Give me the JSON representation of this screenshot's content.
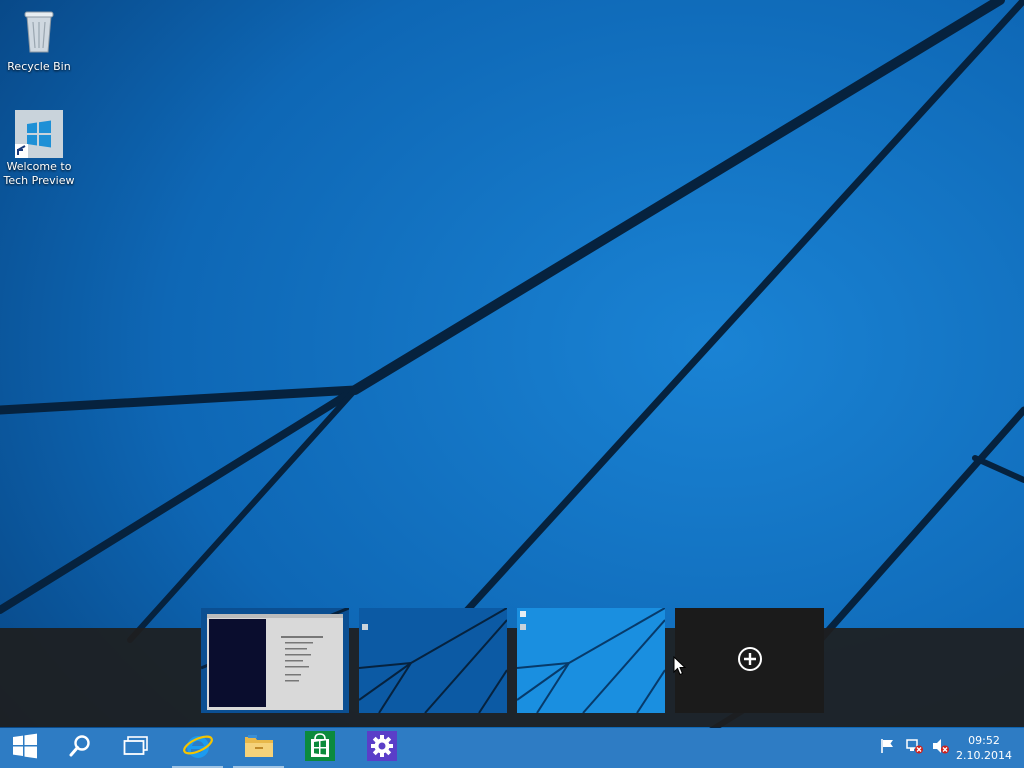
{
  "desktop": {
    "icons": [
      {
        "label": "Recycle Bin",
        "icon": "recycle-bin-icon"
      },
      {
        "label_line1": "Welcome to",
        "label_line2": "Tech Preview",
        "icon": "windows-logo-icon"
      }
    ]
  },
  "task_view": {
    "desktops": [
      {
        "name": "desktop-1",
        "has_window": true
      },
      {
        "name": "desktop-2"
      },
      {
        "name": "desktop-3",
        "active": true
      }
    ],
    "add_desktop_icon": "plus-circle-icon"
  },
  "taskbar": {
    "start_icon": "windows-logo-icon",
    "search_icon": "search-icon",
    "task_view_icon": "task-view-icon",
    "pinned": [
      {
        "name": "Internet Explorer",
        "icon": "internet-explorer-icon"
      },
      {
        "name": "File Explorer",
        "icon": "file-explorer-icon"
      },
      {
        "name": "Store",
        "icon": "store-icon"
      },
      {
        "name": "Settings",
        "icon": "settings-gear-icon"
      }
    ],
    "tray_icons": [
      "action-center-flag-icon",
      "network-disconnected-icon",
      "volume-muted-icon"
    ],
    "clock": {
      "time": "09:52",
      "date": "2.10.2014"
    }
  },
  "colors": {
    "taskbar": "#2e7cc4",
    "wallpaper": "#0d5ca8",
    "store_green": "#0b8a3c",
    "settings_purple": "#5a3ec8"
  }
}
